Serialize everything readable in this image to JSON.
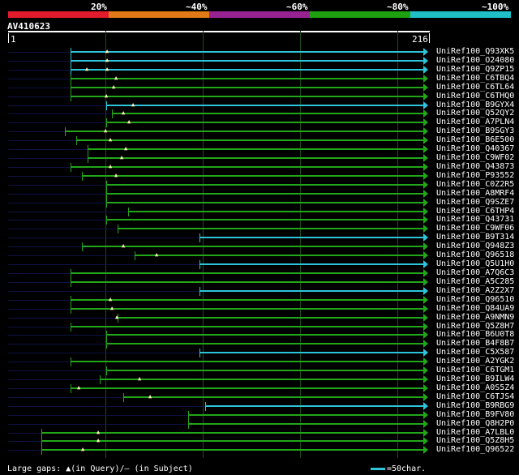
{
  "scale": {
    "marks": [
      "20%",
      "~40%",
      "~60%",
      "~80%",
      "~100%"
    ],
    "colors": [
      "#e01c2c",
      "#e07a16",
      "#972393",
      "#1ea011",
      "#1fbfc8"
    ]
  },
  "query": {
    "name": "AV410623",
    "start": "1",
    "end": "216"
  },
  "colors": {
    "cyan": "#2ec4da",
    "green": "#22a61a",
    "track": "#0e1244",
    "gap_marker": "#ffffc0"
  },
  "hits": [
    {
      "name": "UniRef100_Q93XK5",
      "start": 87,
      "color": "cyan",
      "gaps": [
        133
      ]
    },
    {
      "name": "UniRef100_O24080",
      "start": 87,
      "color": "cyan",
      "gaps": [
        133
      ]
    },
    {
      "name": "UniRef100_Q9ZP15",
      "start": 87,
      "color": "cyan",
      "gaps": [
        108,
        133
      ]
    },
    {
      "name": "UniRef100_C6TBQ4",
      "start": 87,
      "color": "green",
      "gaps": [
        144
      ]
    },
    {
      "name": "UniRef100_C6TL64",
      "start": 87,
      "color": "green",
      "gaps": [
        141
      ]
    },
    {
      "name": "UniRef100_C6THQ0",
      "start": 87,
      "color": "green",
      "gaps": [
        132
      ]
    },
    {
      "name": "UniRef100_B9GYX4",
      "start": 131,
      "color": "cyan",
      "gaps": [
        165
      ]
    },
    {
      "name": "UniRef100_Q52QY2",
      "start": 138,
      "color": "green",
      "gaps": [
        153
      ]
    },
    {
      "name": "UniRef100_A7PLN4",
      "start": 131,
      "color": "green",
      "gaps": [
        160
      ]
    },
    {
      "name": "UniRef100_B9SGY3",
      "start": 80,
      "color": "green",
      "gaps": [
        131
      ]
    },
    {
      "name": "UniRef100_B6E500",
      "start": 94,
      "color": "green",
      "gaps": [
        137
      ]
    },
    {
      "name": "UniRef100_Q40367",
      "start": 108,
      "color": "green",
      "gaps": [
        156
      ]
    },
    {
      "name": "UniRef100_C9WF02",
      "start": 108,
      "color": "green",
      "gaps": [
        151
      ]
    },
    {
      "name": "UniRef100_Q43873",
      "start": 87,
      "color": "green",
      "gaps": [
        137
      ]
    },
    {
      "name": "UniRef100_P93552",
      "start": 101,
      "color": "green",
      "gaps": [
        144
      ]
    },
    {
      "name": "UniRef100_C0Z2R5",
      "start": 131,
      "color": "green",
      "gaps": []
    },
    {
      "name": "UniRef100_A8MRF4",
      "start": 131,
      "color": "green",
      "gaps": []
    },
    {
      "name": "UniRef100_Q9SZE7",
      "start": 131,
      "color": "green",
      "gaps": []
    },
    {
      "name": "UniRef100_C6THP4",
      "start": 158,
      "color": "green",
      "gaps": []
    },
    {
      "name": "UniRef100_Q43731",
      "start": 131,
      "color": "green",
      "gaps": []
    },
    {
      "name": "UniRef100_C9WF06",
      "start": 145,
      "color": "green",
      "gaps": []
    },
    {
      "name": "UniRef100_B9T314",
      "start": 246,
      "color": "cyan",
      "gaps": []
    },
    {
      "name": "UniRef100_Q948Z3",
      "start": 101,
      "color": "green",
      "gaps": [
        153
      ]
    },
    {
      "name": "UniRef100_Q96518",
      "start": 166,
      "color": "green",
      "gaps": [
        194
      ]
    },
    {
      "name": "UniRef100_Q5U1H0",
      "start": 246,
      "color": "cyan",
      "gaps": []
    },
    {
      "name": "UniRef100_A7Q6C3",
      "start": 87,
      "color": "green",
      "gaps": []
    },
    {
      "name": "UniRef100_A5C285",
      "start": 87,
      "color": "green",
      "gaps": []
    },
    {
      "name": "UniRef100_A2Z2X7",
      "start": 246,
      "color": "cyan",
      "gaps": []
    },
    {
      "name": "UniRef100_Q96510",
      "start": 87,
      "color": "green",
      "gaps": [
        137
      ]
    },
    {
      "name": "UniRef100_Q84UA9",
      "start": 87,
      "color": "green",
      "gaps": [
        139
      ]
    },
    {
      "name": "UniRef100_A9NMN9",
      "start": 145,
      "color": "green",
      "gaps": [
        145
      ]
    },
    {
      "name": "UniRef100_Q5Z8H7",
      "start": 87,
      "color": "green",
      "gaps": []
    },
    {
      "name": "UniRef100_B6U0T8",
      "start": 131,
      "color": "green",
      "gaps": []
    },
    {
      "name": "UniRef100_B4F8B7",
      "start": 131,
      "color": "green",
      "gaps": []
    },
    {
      "name": "UniRef100_C5X587",
      "start": 246,
      "color": "cyan",
      "gaps": []
    },
    {
      "name": "UniRef100_A2YGK2",
      "start": 87,
      "color": "green",
      "gaps": []
    },
    {
      "name": "UniRef100_C6TGM1",
      "start": 131,
      "color": "green",
      "gaps": []
    },
    {
      "name": "UniRef100_B9ILW4",
      "start": 123,
      "color": "green",
      "gaps": [
        173
      ]
    },
    {
      "name": "UniRef100_A0S5Z4",
      "start": 87,
      "color": "green",
      "gaps": [
        98
      ]
    },
    {
      "name": "UniRef100_C6TJS4",
      "start": 152,
      "color": "green",
      "gaps": [
        186
      ]
    },
    {
      "name": "UniRef100_B9RBG9",
      "start": 253,
      "color": "cyan",
      "gaps": []
    },
    {
      "name": "UniRef100_B9FV80",
      "start": 232,
      "color": "green",
      "gaps": []
    },
    {
      "name": "UniRef100_Q8H2P0",
      "start": 232,
      "color": "green",
      "gaps": []
    },
    {
      "name": "UniRef100_A7LBL0",
      "start": 51,
      "color": "green",
      "gaps": [
        122
      ]
    },
    {
      "name": "UniRef100_Q5Z8H5",
      "start": 51,
      "color": "green",
      "gaps": [
        122
      ]
    },
    {
      "name": "UniRef100_Q96522",
      "start": 51,
      "color": "green",
      "gaps": [
        103
      ]
    }
  ],
  "legend": {
    "gaps_text": "Large gaps: ▲(in Query)/– (in Subject)",
    "scale_text": "=50char."
  }
}
